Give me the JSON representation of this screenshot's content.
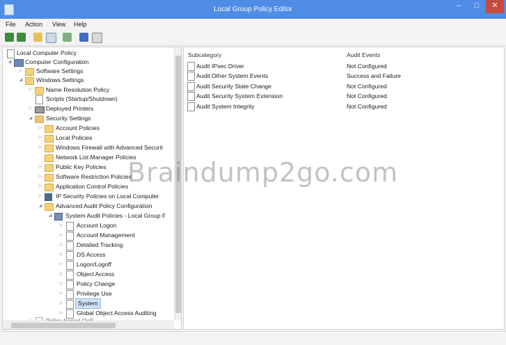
{
  "window": {
    "title": "Local Group Policy Editor",
    "minimize": "–",
    "maximize": "□",
    "close": "✕"
  },
  "menu": [
    "File",
    "Action",
    "View",
    "Help"
  ],
  "toolbar": [
    "back-icon",
    "forward-icon",
    "up-folder-icon",
    "show-hide-tree-icon",
    "export-list-icon",
    "help-icon",
    "properties-icon"
  ],
  "tree": [
    {
      "label": "Local Computer Policy",
      "icon": "policy-icon"
    },
    {
      "label": "Computer Configuration",
      "icon": "computer-icon"
    },
    {
      "label": "Software Settings",
      "icon": "folder-icon"
    },
    {
      "label": "Windows Settings",
      "icon": "folder-icon"
    },
    {
      "label": "Name Resolution Policy",
      "icon": "folder-icon"
    },
    {
      "label": "Scripts (Startup/Shutdown)",
      "icon": "document-icon"
    },
    {
      "label": "Deployed Printers",
      "icon": "printer-icon"
    },
    {
      "label": "Security Settings",
      "icon": "security-icon"
    },
    {
      "label": "Account Policies",
      "icon": "folder-icon"
    },
    {
      "label": "Local Policies",
      "icon": "folder-icon"
    },
    {
      "label": "Windows Firewall with Advanced Securit",
      "icon": "folder-icon"
    },
    {
      "label": "Network List Manager Policies",
      "icon": "folder-icon"
    },
    {
      "label": "Public Key Policies",
      "icon": "folder-icon"
    },
    {
      "label": "Software Restriction Policies",
      "icon": "folder-icon"
    },
    {
      "label": "Application Control Policies",
      "icon": "folder-icon"
    },
    {
      "label": "IP Security Policies on Local Computer",
      "icon": "shield-icon"
    },
    {
      "label": "Advanced Audit Policy Configuration",
      "icon": "folder-icon"
    },
    {
      "label": "System Audit Policies - Local Group F",
      "icon": "audit-icon"
    },
    {
      "label": "Account Logon",
      "icon": "document-icon"
    },
    {
      "label": "Account Management",
      "icon": "document-icon"
    },
    {
      "label": "Detailed Tracking",
      "icon": "document-icon"
    },
    {
      "label": "DS Access",
      "icon": "document-icon"
    },
    {
      "label": "Logon/Logoff",
      "icon": "document-icon"
    },
    {
      "label": "Object Access",
      "icon": "document-icon"
    },
    {
      "label": "Policy Change",
      "icon": "document-icon"
    },
    {
      "label": "Privilege Use",
      "icon": "document-icon"
    },
    {
      "label": "System",
      "icon": "document-icon"
    },
    {
      "label": "Global Object Access Auditing",
      "icon": "document-icon"
    },
    {
      "label": "Policy-based QoS",
      "icon": "chart-icon"
    }
  ],
  "list": {
    "columns": [
      "Subcategory",
      "Audit Events"
    ],
    "rows": [
      {
        "subcategory": "Audit IPsec Driver",
        "events": "Not Configured"
      },
      {
        "subcategory": "Audit Other System Events",
        "events": "Success and Failure"
      },
      {
        "subcategory": "Audit Security State Change",
        "events": "Not Configured"
      },
      {
        "subcategory": "Audit Security System Extension",
        "events": "Not Configured"
      },
      {
        "subcategory": "Audit System Integrity",
        "events": "Not Configured"
      }
    ]
  },
  "watermark": "Braindump2go.com",
  "colors": {
    "titlebar": "#4e8ce6",
    "selection": "#cfe3f7",
    "close": "#c74b3c"
  }
}
